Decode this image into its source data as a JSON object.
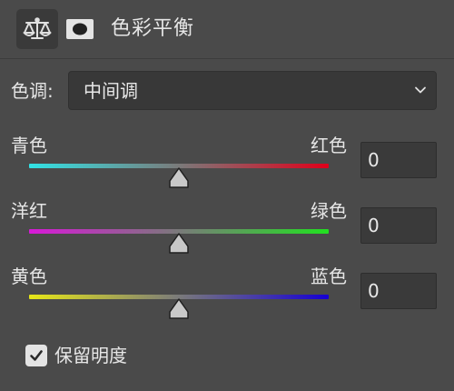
{
  "panel": {
    "title": "色彩平衡",
    "adjustment_icon": "balance-scale-icon",
    "mask_icon": "layer-mask-icon"
  },
  "tone": {
    "label": "色调:",
    "selected": "中间调"
  },
  "sliders": [
    {
      "left_label": "青色",
      "right_label": "红色",
      "value": "0",
      "left_color": "#31e3e6",
      "right_color": "#e0001a"
    },
    {
      "left_label": "洋红",
      "right_label": "绿色",
      "value": "0",
      "left_color": "#d819d8",
      "right_color": "#21e120"
    },
    {
      "left_label": "黄色",
      "right_label": "蓝色",
      "value": "0",
      "left_color": "#e6e617",
      "right_color": "#1600d4"
    }
  ],
  "preserve_luminosity": {
    "label": "保留明度",
    "checked": true
  }
}
